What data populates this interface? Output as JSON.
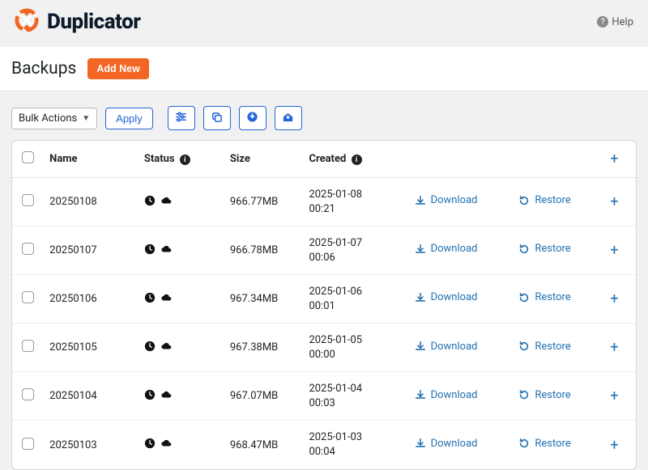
{
  "brand": {
    "name": "Duplicator"
  },
  "header": {
    "help_label": "Help"
  },
  "page": {
    "title": "Backups",
    "add_new_label": "Add New"
  },
  "toolbar": {
    "bulk_label": "Bulk Actions",
    "apply_label": "Apply"
  },
  "table": {
    "columns": {
      "name": "Name",
      "status": "Status",
      "size": "Size",
      "created": "Created"
    },
    "download_label": "Download",
    "restore_label": "Restore",
    "rows": [
      {
        "name": "20250108",
        "size": "966.77MB",
        "created_date": "2025-01-08",
        "created_time": "00:21"
      },
      {
        "name": "20250107",
        "size": "966.78MB",
        "created_date": "2025-01-07",
        "created_time": "00:06"
      },
      {
        "name": "20250106",
        "size": "967.34MB",
        "created_date": "2025-01-06",
        "created_time": "00:01"
      },
      {
        "name": "20250105",
        "size": "967.38MB",
        "created_date": "2025-01-05",
        "created_time": "00:00"
      },
      {
        "name": "20250104",
        "size": "967.07MB",
        "created_date": "2025-01-04",
        "created_time": "00:03"
      },
      {
        "name": "20250103",
        "size": "968.47MB",
        "created_date": "2025-01-03",
        "created_time": "00:04"
      }
    ]
  }
}
